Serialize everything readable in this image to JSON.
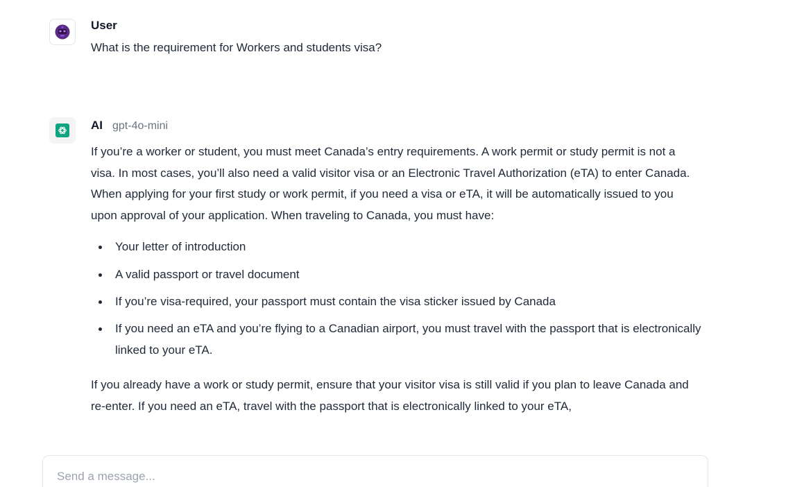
{
  "conversation": {
    "user_message": {
      "sender": "User",
      "avatar_icon": "robot-face-icon",
      "text": "What is the requirement for Workers and students visa?"
    },
    "ai_message": {
      "sender": "AI",
      "model": "gpt-4o-mini",
      "avatar_icon": "openai-logo-icon",
      "paragraph_1": "If you’re a worker or student, you must meet Canada’s entry requirements. A work permit or study permit is not a visa. In most cases, you’ll also need a valid visitor visa or an Electronic Travel Authorization (eTA) to enter Canada.",
      "paragraph_2": "When applying for your first study or work permit, if you need a visa or eTA, it will be automatically issued to you upon approval of your application. When traveling to Canada, you must have:",
      "bullets": [
        "Your letter of introduction",
        "A valid passport or travel document",
        "If you’re visa-required, your passport must contain the visa sticker issued by Canada",
        "If you need an eTA and you’re flying to a Canadian airport, you must travel with the passport that is electronically linked to your eTA."
      ],
      "paragraph_3": "If you already have a work or study permit, ensure that your visitor visa is still valid if you plan to leave Canada and re-enter. If you need an eTA, travel with the passport that is electronically linked to your eTA,"
    }
  },
  "composer": {
    "placeholder": "Send a message..."
  },
  "colors": {
    "openai_brand": "#10a37f",
    "robot_avatar": "#5b2a86"
  }
}
